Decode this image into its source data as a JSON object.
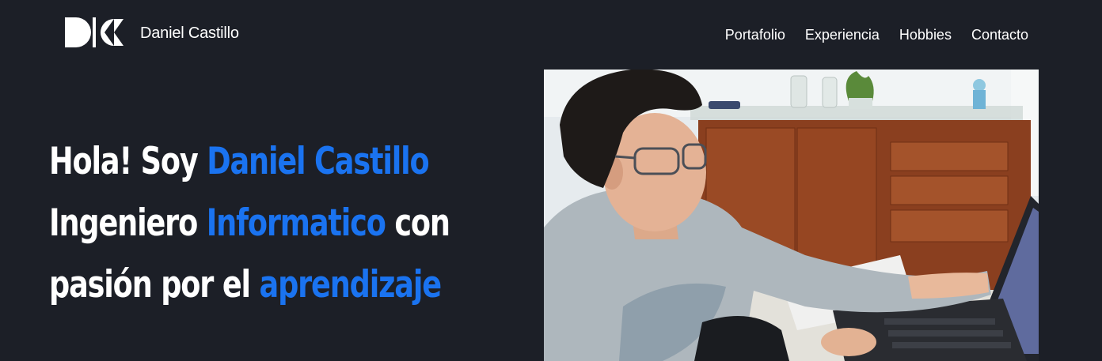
{
  "header": {
    "logo_icon": "dc-monogram-logo",
    "brand_name": "Daniel Castillo",
    "nav": [
      {
        "label": "Portafolio"
      },
      {
        "label": "Experiencia"
      },
      {
        "label": "Hobbies"
      },
      {
        "label": "Contacto"
      }
    ]
  },
  "hero": {
    "line1": {
      "prefix": "Hola! Soy ",
      "highlight": "Daniel Castillo",
      "suffix": ""
    },
    "line2": {
      "prefix": "Ingeniero ",
      "highlight": "Informatico",
      "suffix": " con"
    },
    "line3": {
      "prefix": "pasión por el ",
      "highlight": "aprendizaje",
      "suffix": ""
    },
    "photo_icon": "profile-photo"
  },
  "colors": {
    "background": "#1c1f27",
    "accent": "#1a73f0",
    "text": "#ffffff"
  }
}
